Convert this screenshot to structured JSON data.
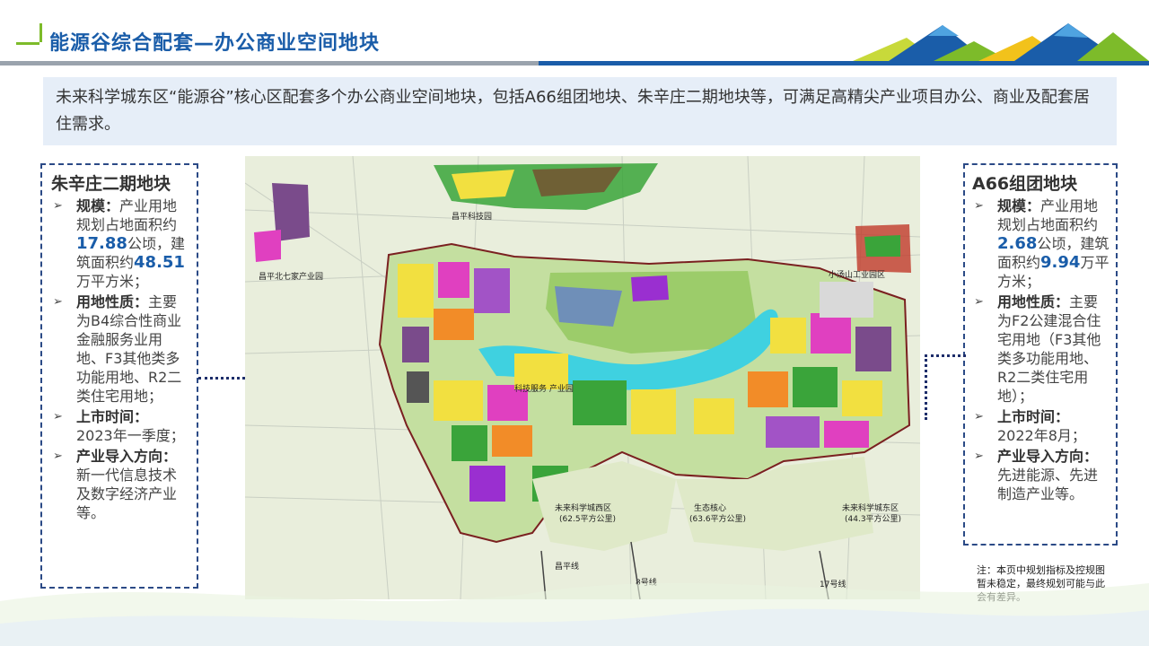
{
  "header": {
    "title": "能源谷综合配套—办公商业空间地块"
  },
  "intro": {
    "text": "未来科学城东区“能源谷”核心区配套多个办公商业空间地块，包括A66组团地块、朱辛庄二期地块等，可满足高精尖产业项目办公、商业及配套居住需求。"
  },
  "left_panel": {
    "title": "朱辛庄二期地块",
    "scale_label": "规模：",
    "scale_text_1": "产业用地规划占地面积约",
    "scale_area": "17.88",
    "scale_text_2": "公顷，建筑面积约",
    "scale_floor": "48.51",
    "scale_text_3": "万平方米；",
    "land_label": "用地性质：",
    "land_text": "主要为B4综合性商业金融服务业用地、F3其他类多功能用地、R2二类住宅用地；",
    "time_label": "上市时间：",
    "time_text": "2023年一季度；",
    "industry_label": "产业导入方向：",
    "industry_text": "新一代信息技术及数字经济产业等。"
  },
  "right_panel": {
    "title": "A66组团地块",
    "scale_label": "规模：",
    "scale_text_1": "产业用地规划占地面积约",
    "scale_area": "2.68",
    "scale_text_2": "公顷，建筑面积约",
    "scale_floor": "9.94",
    "scale_text_3": "万平方米；",
    "land_label": "用地性质：",
    "land_text": "主要为F2公建混合住宅用地（F3其他类多功能用地、R2二类住宅用地）；",
    "time_label": "上市时间：",
    "time_text": "2022年8月；",
    "industry_label": "产业导入方向：",
    "industry_text": "先进能源、先进制造产业等。"
  },
  "map": {
    "labels": {
      "north_park": "昌平科技园",
      "west_park": "昌平北七家产业园",
      "east_park": "小汤山工业园区",
      "west_district": "未来科学城西区",
      "west_area": "(62.5平方公里)",
      "eco": "生态核心",
      "eco_area": "(63.6平方公里)",
      "east_district": "未来科学城东区",
      "east_area": "(44.3平方公里)",
      "center": "科技服务\n产业园",
      "line_a": "昌平线",
      "line_b": "8号线",
      "line_c": "17号线"
    }
  },
  "note": {
    "text": "注：本页中规划指标及控规图暂未稳定，最终规划可能与此会有差异。"
  },
  "colors": {
    "brand_blue": "#1a5da9",
    "accent_green": "#7dbb2a",
    "panel_border": "#2b4a86",
    "intro_bg": "#e6eef8"
  }
}
